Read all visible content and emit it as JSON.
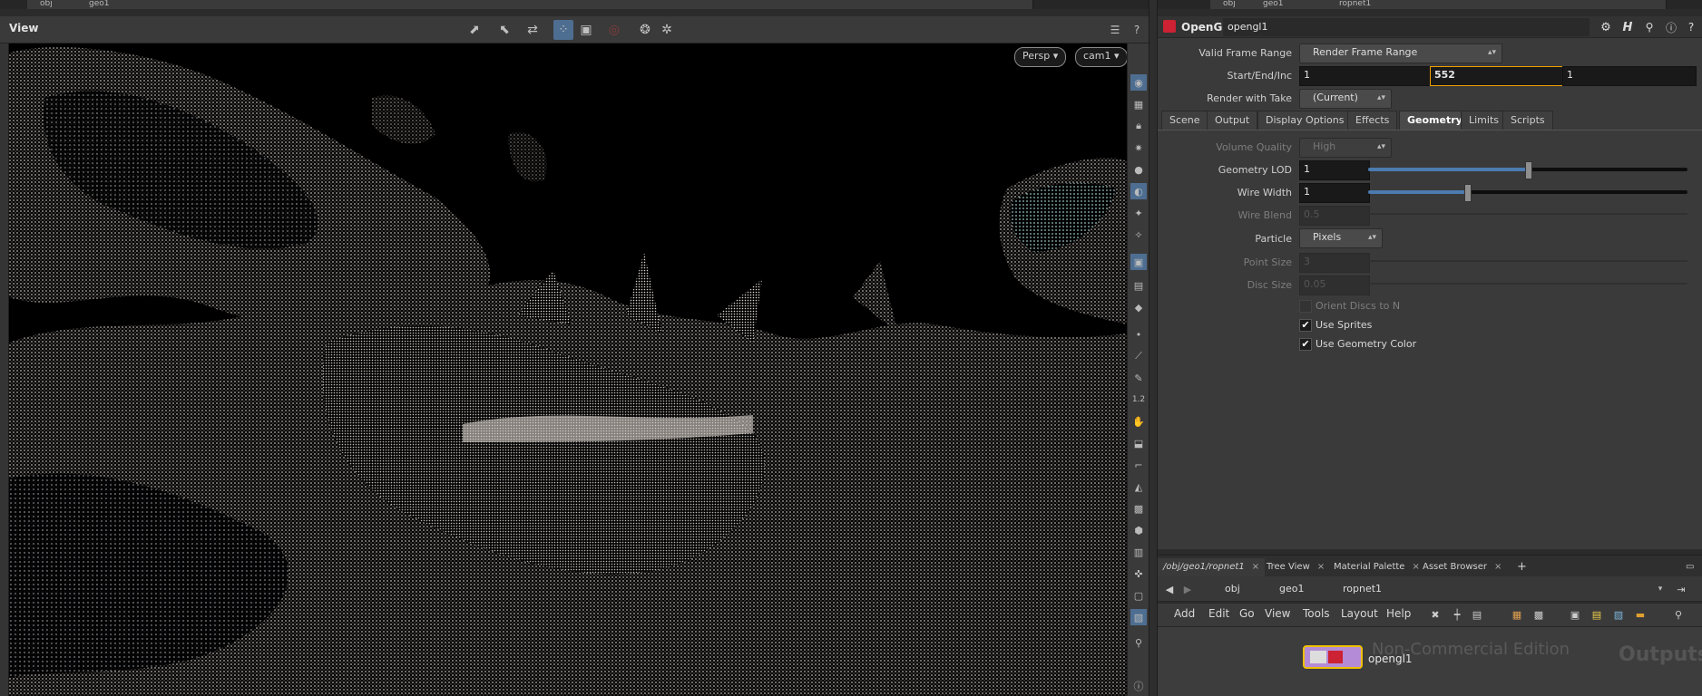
{
  "top_strip": {
    "left": [
      "obj",
      "geo1"
    ],
    "right": [
      "obj",
      "geo1",
      "ropnet1"
    ]
  },
  "viewer": {
    "title": "View",
    "camera_view": "Persp",
    "camera_name": "cam1"
  },
  "params": {
    "node_type": "OpenGL",
    "node_name": "opengl1",
    "valid_frame_range_label": "Valid Frame Range",
    "valid_frame_range_value": "Render Frame Range",
    "start_end_inc_label": "Start/End/Inc",
    "start": "1",
    "end": "552",
    "inc": "1",
    "render_with_take_label": "Render with Take",
    "render_with_take_value": "(Current)",
    "tabs": [
      "Scene",
      "Output",
      "Display Options",
      "Effects",
      "Geometry",
      "Limits",
      "Scripts"
    ],
    "selected_tab": "Geometry",
    "volume_quality_label": "Volume Quality",
    "volume_quality_value": "High",
    "geometry_lod_label": "Geometry LOD",
    "geometry_lod_value": "1",
    "geometry_lod_fraction": 0.5,
    "wire_width_label": "Wire Width",
    "wire_width_value": "1",
    "wire_width_fraction": 0.31,
    "wire_blend_label": "Wire Blend",
    "wire_blend_value": "0.5",
    "particle_label": "Particle",
    "particle_value": "Pixels",
    "point_size_label": "Point Size",
    "point_size_value": "3",
    "disc_size_label": "Disc Size",
    "disc_size_value": "0.05",
    "orient_discs_label": "Orient Discs to N",
    "use_sprites_label": "Use Sprites",
    "use_sprites_checked": true,
    "use_geometry_color_label": "Use Geometry Color",
    "use_geometry_color_checked": true
  },
  "network": {
    "tabs": [
      "/obj/geo1/ropnet1",
      "Tree View",
      "Material Palette",
      "Asset Browser"
    ],
    "path": [
      "obj",
      "geo1",
      "ropnet1"
    ],
    "menu": [
      "Add",
      "Edit",
      "Go",
      "View",
      "Tools",
      "Layout",
      "Help"
    ],
    "node_label": "opengl1",
    "watermark": "Non-Commercial Edition",
    "context_label": "Outputs"
  }
}
